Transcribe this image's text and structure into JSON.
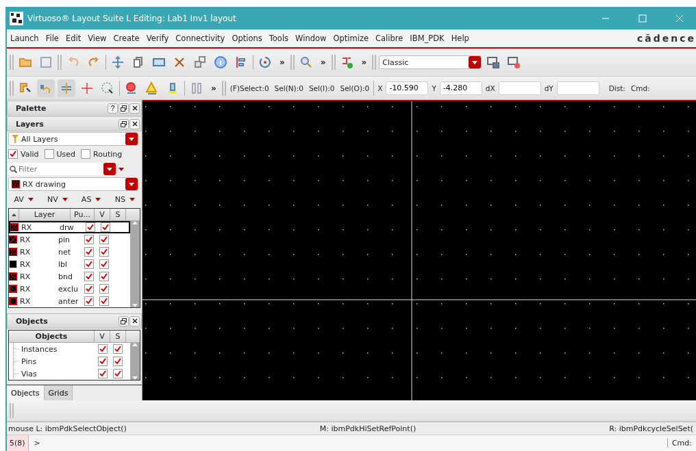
{
  "window": {
    "title": "Virtuoso® Layout Suite L Editing: Lab1 Inv1 layout"
  },
  "menu": [
    "Launch",
    "File",
    "Edit",
    "View",
    "Create",
    "Verify",
    "Connectivity",
    "Options",
    "Tools",
    "Window",
    "Optimize",
    "Calibre",
    "IBM_PDK",
    "Help"
  ],
  "brand": "cādence",
  "toolbar_1": {
    "overflow": [
      "»",
      "»",
      "»"
    ],
    "workspace_select": {
      "value": "Classic"
    }
  },
  "toolbar_2": {
    "overflow": "»",
    "counters": [
      "(F)Select:0",
      "Sel(N):0",
      "Sel(I):0",
      "Sel(O):0"
    ],
    "fields": [
      {
        "label": "X",
        "value": "-10.590"
      },
      {
        "label": "Y",
        "value": "-4.280"
      },
      {
        "label": "dX"
      },
      {
        "label": "dY"
      }
    ],
    "dist": "Dist:",
    "cmd": "Cmd:"
  },
  "palette": {
    "title": "Palette",
    "help": "?"
  },
  "layers": {
    "title": "Layers",
    "filter_select": "All Layers",
    "checkboxes": [
      {
        "label": "Valid",
        "checked": true
      },
      {
        "label": "Used",
        "checked": false
      },
      {
        "label": "Routing",
        "checked": false
      }
    ],
    "search": {
      "placeholder": "Filter"
    },
    "current_layer": "RX drawing",
    "visibility_menus": [
      "AV",
      "NV",
      "AS",
      "NS"
    ],
    "columns": [
      "Layer",
      "Pu...",
      "V",
      "S"
    ],
    "rows": [
      {
        "layer": "RX",
        "purpose": "drw",
        "kind": "dotted",
        "visible": true,
        "selectable": true,
        "selected": true
      },
      {
        "layer": "RX",
        "purpose": "pin",
        "kind": "cross",
        "visible": true,
        "selectable": true,
        "selected": false
      },
      {
        "layer": "RX",
        "purpose": "net",
        "kind": "dotted",
        "visible": true,
        "selectable": true,
        "selected": false
      },
      {
        "layer": "RX",
        "purpose": "lbl",
        "kind": "outline",
        "visible": true,
        "selectable": true,
        "selected": false
      },
      {
        "layer": "RX",
        "purpose": "bnd",
        "kind": "dotted",
        "visible": true,
        "selectable": true,
        "selected": false
      },
      {
        "layer": "RX",
        "purpose": "exclu",
        "kind": "diagonal",
        "visible": true,
        "selectable": true,
        "selected": false
      },
      {
        "layer": "RX",
        "purpose": "anter",
        "kind": "solid",
        "visible": true,
        "selectable": true,
        "selected": false
      }
    ]
  },
  "objects": {
    "title": "Objects",
    "columns": [
      "Objects",
      "V",
      "S"
    ],
    "rows": [
      {
        "name": "Instances",
        "visible": true,
        "selectable": true
      },
      {
        "name": "Pins",
        "visible": true,
        "selectable": true
      },
      {
        "name": "Vias",
        "visible": true,
        "selectable": true
      }
    ]
  },
  "panel_tabs": [
    {
      "label": "Objects",
      "selected": true
    },
    {
      "label": "Grids",
      "selected": false
    }
  ],
  "mouse_status": {
    "left": "mouse L: ibmPdkSelectObject()",
    "middle": "M: ibmPdkHiSetRefPoint()",
    "right": "R: ibmPdkcycleSelSet("
  },
  "command_line": {
    "counter": "5(8)",
    "prompt": ">",
    "cmd": "Cmd:"
  }
}
